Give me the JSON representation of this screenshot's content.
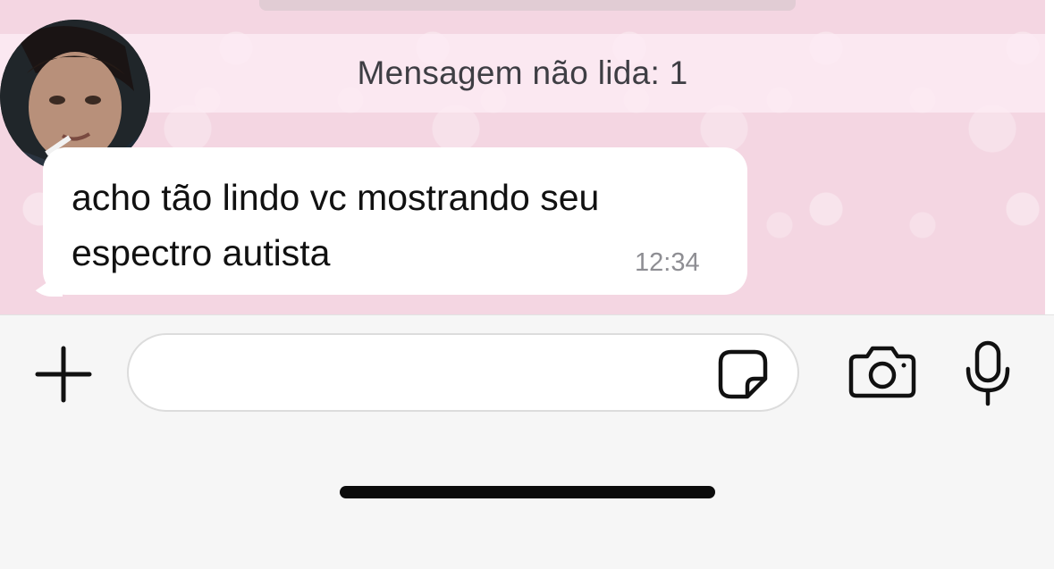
{
  "chat": {
    "unread_banner": "Mensagem não lida: 1",
    "contact_avatar_icon": "contact-avatar",
    "message": {
      "line1": "acho tão lindo vc mostrando seu",
      "line2": "espectro autista",
      "time": "12:34"
    }
  },
  "input_bar": {
    "add_icon": "plus-icon",
    "text_value": "",
    "sticker_icon": "sticker-icon",
    "camera_icon": "camera-icon",
    "mic_icon": "microphone-icon"
  },
  "colors": {
    "chat_background": "#f4d6e2",
    "bubble": "#ffffff",
    "text": "#111111",
    "timestamp": "#8e8e93",
    "input_bar": "#f6f6f6"
  }
}
